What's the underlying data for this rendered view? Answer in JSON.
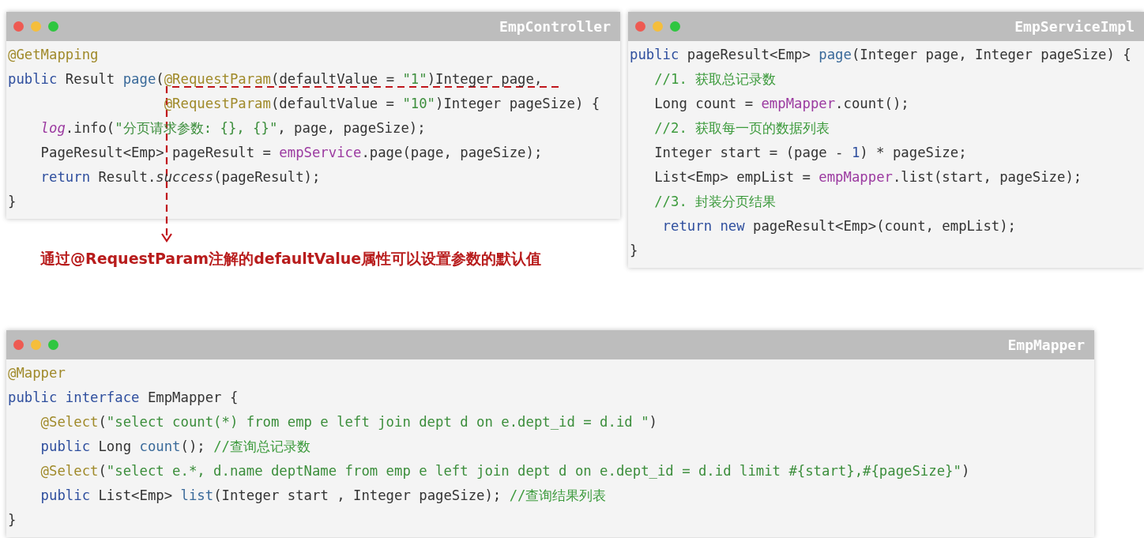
{
  "controller": {
    "title": "EmpController",
    "lines": [
      {
        "kind": "top",
        "tokens": [
          {
            "kind": "annotation",
            "text": "@GetMapping"
          }
        ]
      },
      {
        "kind": "top",
        "tokens": [
          {
            "kind": "keyword",
            "text": "public "
          },
          {
            "kind": "plain",
            "text": "Result "
          },
          {
            "kind": "method",
            "text": "page"
          },
          {
            "kind": "plain",
            "text": "("
          },
          {
            "kind": "annotation",
            "text": "@RequestParam"
          },
          {
            "kind": "plain",
            "text": "(defaultValue = "
          },
          {
            "kind": "string",
            "text": "\"1\""
          },
          {
            "kind": "plain",
            "text": ")Integer page,"
          }
        ]
      },
      {
        "kind": "params",
        "tokens": [
          {
            "kind": "annotation",
            "text": "@RequestParam"
          },
          {
            "kind": "plain",
            "text": "(defaultValue = "
          },
          {
            "kind": "string",
            "text": "\"10\""
          },
          {
            "kind": "plain",
            "text": ")Integer pageSize) {"
          }
        ]
      },
      {
        "kind": "body",
        "tokens": [
          {
            "kind": "field-italic",
            "text": "log"
          },
          {
            "kind": "plain",
            "text": ".info("
          },
          {
            "kind": "string",
            "text": "\"分页请求参数: {}, {}\""
          },
          {
            "kind": "plain",
            "text": ", page, pageSize);"
          }
        ]
      },
      {
        "kind": "body",
        "tokens": [
          {
            "kind": "plain",
            "text": "PageResult<Emp> pageResult = "
          },
          {
            "kind": "field",
            "text": "empService"
          },
          {
            "kind": "plain",
            "text": ".page(page, pageSize);"
          }
        ]
      },
      {
        "kind": "body",
        "tokens": [
          {
            "kind": "keyword",
            "text": "return "
          },
          {
            "kind": "plain",
            "text": "Result."
          },
          {
            "kind": "italic",
            "text": "success"
          },
          {
            "kind": "plain",
            "text": "(pageResult);"
          }
        ]
      },
      {
        "kind": "top",
        "tokens": [
          {
            "kind": "plain",
            "text": "}"
          }
        ]
      }
    ]
  },
  "service": {
    "title": "EmpServiceImpl",
    "lines": [
      {
        "kind": "top",
        "tokens": [
          {
            "kind": "keyword",
            "text": "public "
          },
          {
            "kind": "plain",
            "text": "pageResult<Emp> "
          },
          {
            "kind": "method",
            "text": "page"
          },
          {
            "kind": "plain",
            "text": "(Integer page, Integer pageSize) {"
          }
        ]
      },
      {
        "kind": "body-short",
        "tokens": [
          {
            "kind": "comment",
            "text": "//1. 获取总记录数"
          }
        ]
      },
      {
        "kind": "body-short",
        "tokens": [
          {
            "kind": "plain",
            "text": "Long count = "
          },
          {
            "kind": "field",
            "text": "empMapper"
          },
          {
            "kind": "plain",
            "text": ".count();"
          }
        ]
      },
      {
        "kind": "body-short",
        "tokens": [
          {
            "kind": "comment",
            "text": "//2. 获取每一页的数据列表"
          }
        ]
      },
      {
        "kind": "body-short",
        "tokens": [
          {
            "kind": "plain",
            "text": "Integer start = (page - "
          },
          {
            "kind": "keyword",
            "text": "1"
          },
          {
            "kind": "plain",
            "text": ") * pageSize;"
          }
        ]
      },
      {
        "kind": "body-short",
        "tokens": [
          {
            "kind": "plain",
            "text": "List<Emp> empList = "
          },
          {
            "kind": "field",
            "text": "empMapper"
          },
          {
            "kind": "plain",
            "text": ".list(start, pageSize);"
          }
        ]
      },
      {
        "kind": "body-short",
        "tokens": [
          {
            "kind": "comment",
            "text": "//3. 封装分页结果"
          }
        ]
      },
      {
        "kind": "body",
        "tokens": [
          {
            "kind": "keyword",
            "text": "return new "
          },
          {
            "kind": "plain",
            "text": "pageResult<Emp>(count, empList);"
          }
        ]
      },
      {
        "kind": "top",
        "tokens": [
          {
            "kind": "plain",
            "text": "}"
          }
        ]
      }
    ]
  },
  "note": "通过@RequestParam注解的defaultValue属性可以设置参数的默认值",
  "mapper": {
    "title": "EmpMapper",
    "lines": [
      {
        "kind": "top",
        "tokens": [
          {
            "kind": "annotation",
            "text": "@Mapper"
          }
        ]
      },
      {
        "kind": "top",
        "tokens": [
          {
            "kind": "keyword",
            "text": "public interface "
          },
          {
            "kind": "plain",
            "text": "EmpMapper {"
          }
        ]
      },
      {
        "kind": "body",
        "tokens": [
          {
            "kind": "annotation",
            "text": "@Select"
          },
          {
            "kind": "plain",
            "text": "("
          },
          {
            "kind": "string",
            "text": "\"select count(*) from emp e left join dept d on e.dept_id = d.id \""
          },
          {
            "kind": "plain",
            "text": ")"
          }
        ]
      },
      {
        "kind": "body",
        "tokens": [
          {
            "kind": "keyword",
            "text": "public "
          },
          {
            "kind": "plain",
            "text": "Long "
          },
          {
            "kind": "method",
            "text": "count"
          },
          {
            "kind": "plain",
            "text": "(); "
          },
          {
            "kind": "comment",
            "text": "//查询总记录数"
          }
        ]
      },
      {
        "kind": "body",
        "tokens": [
          {
            "kind": "annotation",
            "text": "@Select"
          },
          {
            "kind": "plain",
            "text": "("
          },
          {
            "kind": "string",
            "text": "\"select e.*, d.name deptName from emp e left join dept d on e.dept_id = d.id limit #{start},#{pageSize}\""
          },
          {
            "kind": "plain",
            "text": ")"
          }
        ]
      },
      {
        "kind": "body",
        "tokens": [
          {
            "kind": "keyword",
            "text": "public "
          },
          {
            "kind": "plain",
            "text": "List<Emp> "
          },
          {
            "kind": "method",
            "text": "list"
          },
          {
            "kind": "plain",
            "text": "(Integer start , Integer pageSize); "
          },
          {
            "kind": "comment",
            "text": "//查询结果列表"
          }
        ]
      },
      {
        "kind": "top",
        "tokens": [
          {
            "kind": "plain",
            "text": "}"
          }
        ]
      }
    ]
  }
}
